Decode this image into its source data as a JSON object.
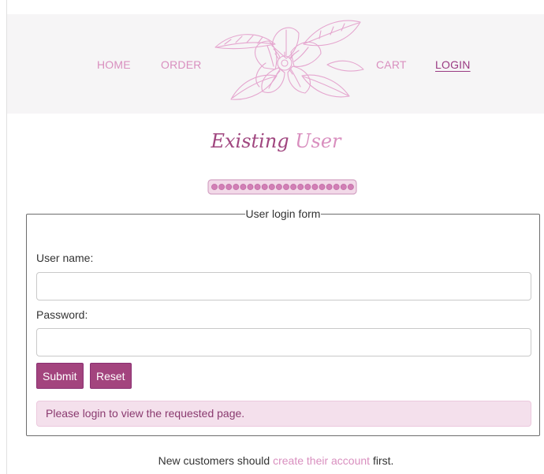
{
  "nav": {
    "home": "HOME",
    "order": "ORDER",
    "cart": "CART",
    "login": "LOGIN",
    "active_color": "#9a3b83",
    "link_color": "#d98fbf"
  },
  "logo": {
    "icon": "magnolia-flower-icon"
  },
  "page": {
    "title_part1": "Existing",
    "title_part2": "User",
    "divider_icon": "pearl-strand-icon"
  },
  "form": {
    "legend": "User login form",
    "username_label": "User name:",
    "username_value": "",
    "password_label": "Password:",
    "password_value": "",
    "submit_label": "Submit",
    "reset_label": "Reset",
    "alert_text": "Please login to view the requested page."
  },
  "footer": {
    "prefix": "New customers should ",
    "link_text": "create their account",
    "suffix": " first."
  },
  "colors": {
    "brand": "#a3447e",
    "accent": "#d98fbf",
    "header_bg": "#f6f5f6",
    "alert_bg": "#f4e0ec"
  }
}
